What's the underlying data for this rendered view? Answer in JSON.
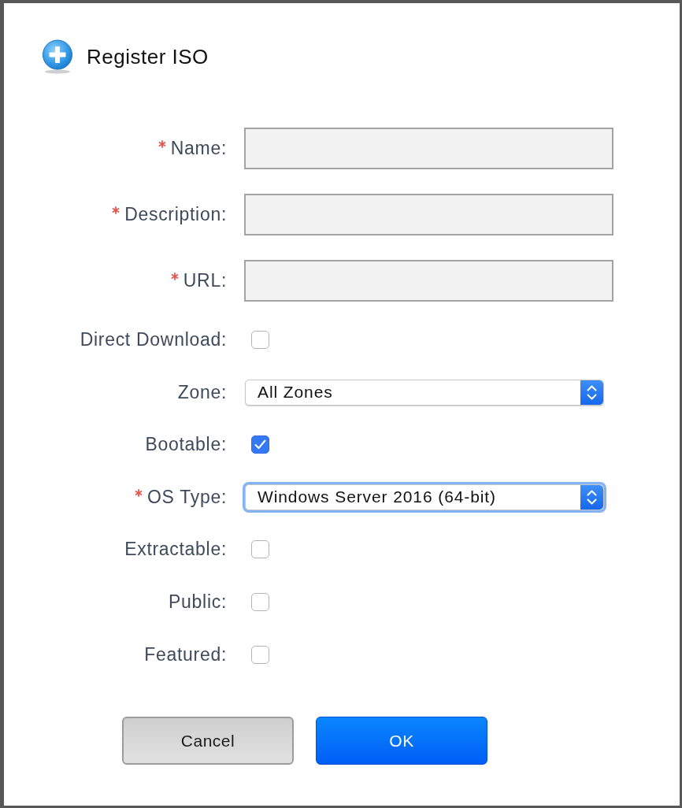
{
  "dialog": {
    "title": "Register ISO"
  },
  "fields": [
    {
      "kind": "text",
      "label": "Name:",
      "required": true
    },
    {
      "kind": "text",
      "label": "Description:",
      "required": true
    },
    {
      "kind": "text",
      "label": "URL:",
      "required": true
    },
    {
      "kind": "checkbox",
      "label": "Direct Download:",
      "required": false,
      "checked": false
    },
    {
      "kind": "select",
      "label": "Zone:",
      "required": false,
      "value": "All Zones",
      "focused": false
    },
    {
      "kind": "checkbox",
      "label": "Bootable:",
      "required": false,
      "checked": true
    },
    {
      "kind": "select",
      "label": "OS Type:",
      "required": true,
      "value": "Windows Server 2016 (64-bit)",
      "focused": true
    },
    {
      "kind": "checkbox",
      "label": "Extractable:",
      "required": false,
      "checked": false
    },
    {
      "kind": "checkbox",
      "label": "Public:",
      "required": false,
      "checked": false
    },
    {
      "kind": "checkbox",
      "label": "Featured:",
      "required": false,
      "checked": false
    }
  ],
  "buttons": [
    {
      "label": "Cancel",
      "kind": "secondary"
    },
    {
      "label": "OK",
      "kind": "primary"
    }
  ]
}
